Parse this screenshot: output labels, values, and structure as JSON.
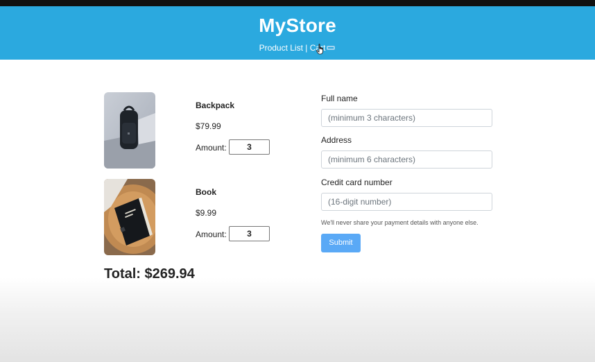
{
  "header": {
    "title": "MyStore",
    "nav_product_list": "Product List",
    "nav_separator": "|",
    "nav_cart": "Cart"
  },
  "cart": {
    "items": [
      {
        "name": "Backpack",
        "price": "$79.99",
        "amount_label": "Amount:",
        "amount": "3"
      },
      {
        "name": "Book",
        "price": "$9.99",
        "amount_label": "Amount:",
        "amount": "3"
      }
    ],
    "total": "Total: $269.94"
  },
  "form": {
    "full_name_label": "Full name",
    "full_name_placeholder": "(minimum 3 characters)",
    "address_label": "Address",
    "address_placeholder": "(minimum 6 characters)",
    "card_label": "Credit card number",
    "card_placeholder": "(16-digit number)",
    "help_text": "We'll never share your payment details with anyone else.",
    "submit_label": "Submit"
  },
  "colors": {
    "header_bg": "#2ba9df",
    "submit_bg": "#5aa9f6"
  }
}
